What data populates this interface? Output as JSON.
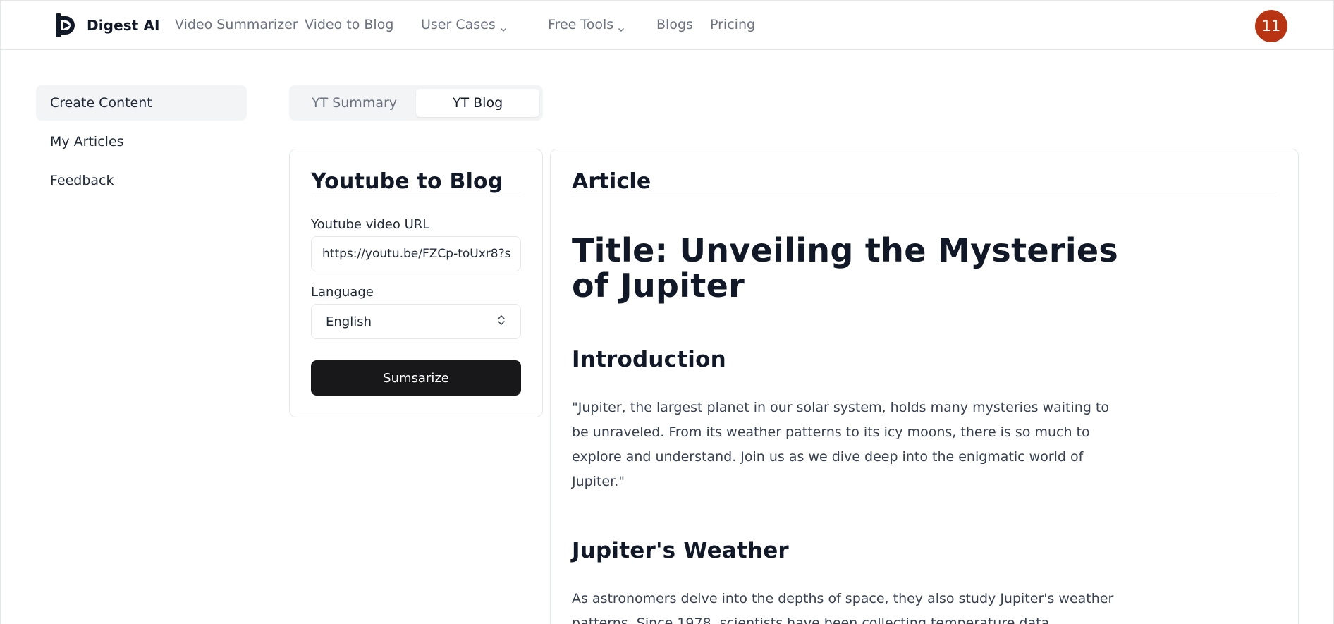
{
  "nav": {
    "brand": "Digest AI",
    "links": {
      "video_summarizer": "Video Summarizer",
      "video_to_blog": "Video to Blog",
      "user_cases": "User Cases",
      "free_tools": "Free Tools",
      "blogs": "Blogs",
      "pricing": "Pricing"
    },
    "avatar_text": "11",
    "avatar_color": "#b93413"
  },
  "sidebar": {
    "items": [
      {
        "label": "Create Content",
        "active": true
      },
      {
        "label": "My Articles",
        "active": false
      },
      {
        "label": "Feedback",
        "active": false
      }
    ]
  },
  "tabs": [
    {
      "label": "YT Summary",
      "active": false
    },
    {
      "label": "YT Blog",
      "active": true
    }
  ],
  "form": {
    "title": "Youtube to Blog",
    "url_label": "Youtube video URL",
    "url_value": "https://youtu.be/FZCp-toUxr8?s",
    "language_label": "Language",
    "language_value": "English",
    "submit_label": "Sumsarize"
  },
  "article": {
    "header": "Article",
    "title": "Title: Unveiling the Mysteries of Jupiter",
    "sections": [
      {
        "heading": "Introduction",
        "body": "\"Jupiter, the largest planet in our solar system, holds many mysteries waiting to be unraveled. From its weather patterns to its icy moons, there is so much to explore and understand. Join us as we dive deep into the enigmatic world of Jupiter.\""
      },
      {
        "heading": "Jupiter's Weather",
        "body": "As astronomers delve into the depths of space, they also study Jupiter's weather patterns. Since 1978, scientists have been collecting temperature data"
      }
    ]
  }
}
